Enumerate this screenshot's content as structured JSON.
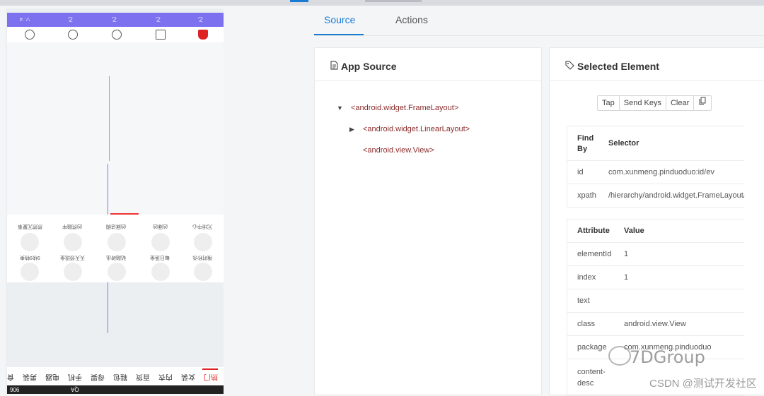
{
  "phone": {
    "statusbar_items": [
      "ソ.ˆ4",
      "乙",
      "乙",
      "乙",
      "乙"
    ],
    "grid_row1": [
      "然然冗夏事",
      "凶然融牢",
      "凶寐洁稠",
      "凶寐凶",
      "冗顷中心"
    ],
    "grid_row2": [
      "9块9特卖",
      "天天领现金",
      "砧融砖出",
      "每日落金",
      "限时秒杀"
    ],
    "categories": [
      "热门",
      "女装",
      "内衣",
      "百货",
      "鞋包",
      "母婴",
      "手机",
      "电器",
      "男装",
      "食"
    ],
    "bottom_text": [
      "906",
      "QA"
    ]
  },
  "tabs": {
    "source": "Source",
    "actions": "Actions"
  },
  "app_source": {
    "title": "App Source",
    "nodes": [
      "<android.widget.FrameLayout>",
      "<android.widget.LinearLayout>",
      "<android.view.View>"
    ]
  },
  "selected_element": {
    "title": "Selected Element",
    "buttons": {
      "tap": "Tap",
      "send_keys": "Send Keys",
      "clear": "Clear"
    },
    "selector_header": {
      "find_by": "Find By",
      "selector": "Selector"
    },
    "selectors": [
      {
        "find_by": "id",
        "selector": "com.xunmeng.pinduoduo:id/ev"
      },
      {
        "find_by": "xpath",
        "selector": "/hierarchy/android.widget.FrameLayout/and"
      }
    ],
    "attribute_header": {
      "attribute": "Attribute",
      "value": "Value"
    },
    "attributes": [
      {
        "attribute": "elementId",
        "value": "1"
      },
      {
        "attribute": "index",
        "value": "1"
      },
      {
        "attribute": "text",
        "value": ""
      },
      {
        "attribute": "class",
        "value": "android.view.View"
      },
      {
        "attribute": "package",
        "value": "com.xunmeng.pinduoduo"
      },
      {
        "attribute": "content-desc",
        "value": ""
      }
    ]
  },
  "watermark": {
    "brand": "7DGroup",
    "sub": "CSDN @测试开发社区"
  }
}
